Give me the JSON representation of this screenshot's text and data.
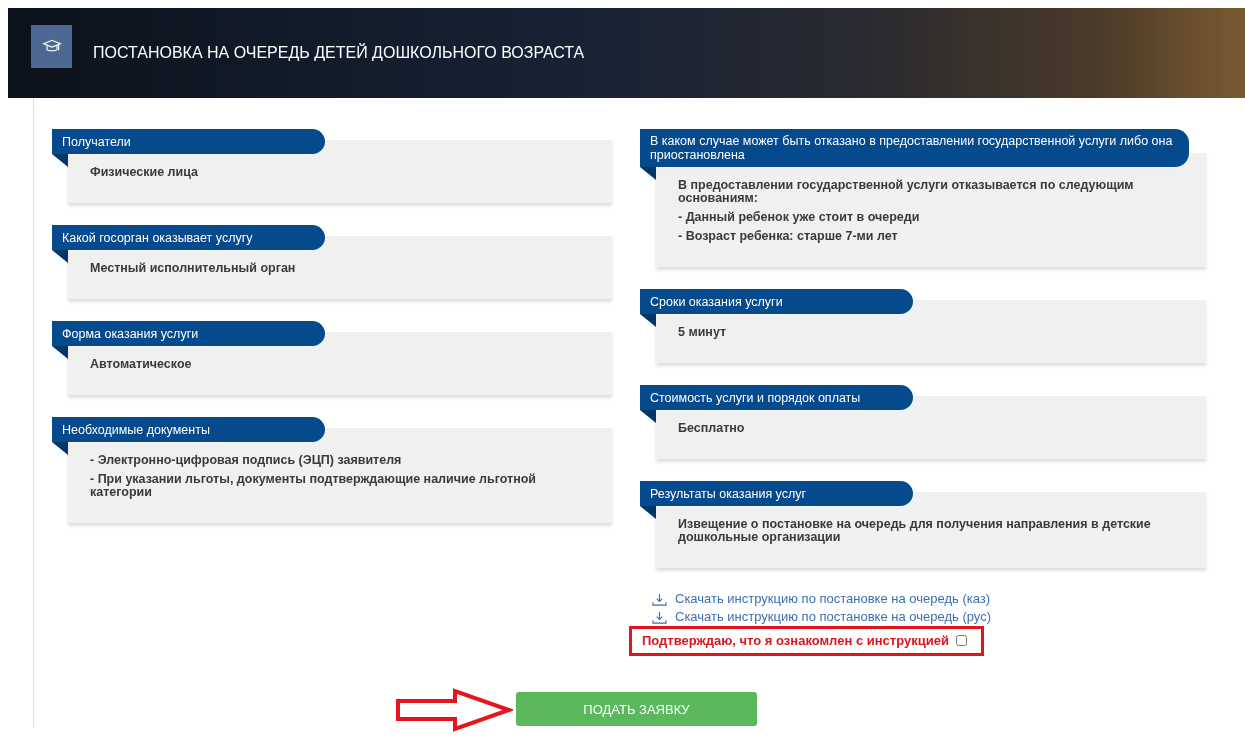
{
  "page_title": "ПОСТАНОВКА НА ОЧЕРЕДЬ ДЕТЕЙ ДОШКОЛЬНОГО ВОЗРАСТА",
  "cards_left": [
    {
      "title": "Получатели",
      "lines": [
        "Физические лица"
      ]
    },
    {
      "title": "Какой госорган оказывает услугу",
      "lines": [
        "Местный исполнительный орган"
      ]
    },
    {
      "title": "Форма оказания услуги",
      "lines": [
        "Автоматическое"
      ]
    },
    {
      "title": "Необходимые документы",
      "lines": [
        "- Электронно-цифровая подпись (ЭЦП) заявителя",
        "- При указании льготы, документы подтверждающие наличие льготной категории"
      ]
    }
  ],
  "cards_right": [
    {
      "title": "В каком случае может быть отказано в предоставлении государственной услуги либо она приостановлена",
      "lines": [
        "В предоставлении государственной услуги отказывается по следующим основаниям:",
        "- Данный ребенок уже стоит в очереди",
        "- Возраст ребенка: старше 7-ми лет"
      ]
    },
    {
      "title": "Сроки оказания услуги",
      "lines": [
        "5 минут"
      ]
    },
    {
      "title": "Стоимость услуги и порядок оплаты",
      "lines": [
        "Бесплатно"
      ]
    },
    {
      "title": "Результаты оказания услуг",
      "lines": [
        "Извещение о постановке на очередь для получения направления в детские дошкольные организации"
      ]
    }
  ],
  "download_links": [
    "Скачать инструкцию по постановке на очередь (каз)",
    "Скачать инструкцию по постановке на очередь (рус)"
  ],
  "confirm": {
    "label": "Подтверждаю, что я ознакомлен с инструкцией",
    "checked": false
  },
  "submit_button": "ПОДАТЬ ЗАЯВКУ"
}
